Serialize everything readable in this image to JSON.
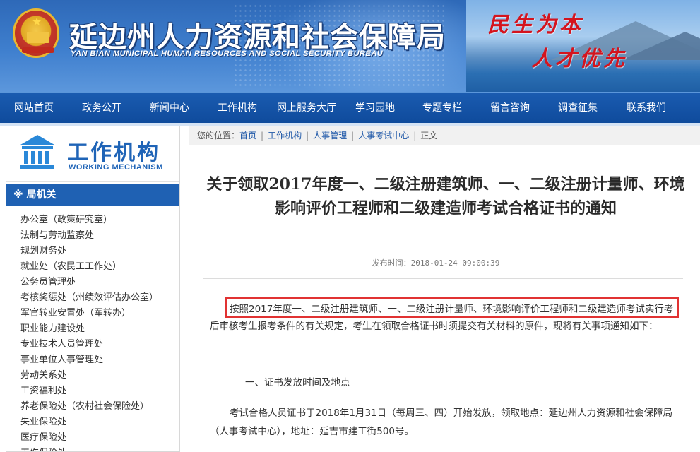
{
  "header": {
    "title": "延边州人力资源和社会保障局",
    "subtitle": "YAN BIAN MUNICIPAL HUMAN RESOURCES AND SOCIAL SECURITY BUREAU",
    "slogan_line1": "民生为本",
    "slogan_line2": "人才优先"
  },
  "nav": {
    "items": [
      "网站首页",
      "政务公开",
      "新闻中心",
      "工作机构",
      "网上服务大厅",
      "学习园地",
      "专题专栏",
      "留言咨询",
      "调查征集",
      "联系我们"
    ]
  },
  "sidebar": {
    "title": "工作机构",
    "title_en": "WORKING MECHANISM",
    "section_label": "※ 局机关",
    "items": [
      "办公室（政策研究室）",
      "法制与劳动监察处",
      "规划财务处",
      "就业处（农民工工作处）",
      "公务员管理处",
      "考核奖惩处（州绩效评估办公室）",
      "军官转业安置处（军转办）",
      "职业能力建设处",
      "专业技术人员管理处",
      "事业单位人事管理处",
      "劳动关系处",
      "工资福利处",
      "养老保险处（农村社会保险处）",
      "失业保险处",
      "医疗保险处",
      "工伤保险处"
    ]
  },
  "breadcrumb": {
    "prefix": "您的位置：",
    "items": [
      "首页",
      "工作机构",
      "人事管理",
      "人事考试中心",
      "正文"
    ]
  },
  "article": {
    "title": "关于领取2017年度一、二级注册建筑师、一、二级注册计量师、环境影响评价工程师和二级建造师考试合格证书的通知",
    "pubtime_label": "发布时间：",
    "pubtime_value": "2018-01-24 09:00:39",
    "paragraph1_highlighted": "按照2017年度一、二级注册建筑师、一、二级注册计量师、环境影响评价工程师和二级建造师考试实行",
    "paragraph1_rest": "考后审核考生报考条件的有关规定，考生在领取合格证书时须提交有关材料的原件，现将有关事项通知如下：",
    "section1_heading": "一、证书发放时间及地点",
    "section1_text": "考试合格人员证书于2018年1月31日（每周三、四）开始发放，领取地点：延边州人力资源和社会保障局（人事考试中心），地址：延吉市建工街500号。"
  },
  "colors": {
    "header_blue": "#3f7fce",
    "nav_blue": "#0f4b9c",
    "sidebar_bar": "#1f61b3",
    "slogan_red": "#d4141e",
    "highlight_red": "#e13232",
    "link_blue": "#1f58a8"
  },
  "icons": {
    "emblem": "national-emblem-icon",
    "sidebar_logo": "government-building-icon"
  }
}
